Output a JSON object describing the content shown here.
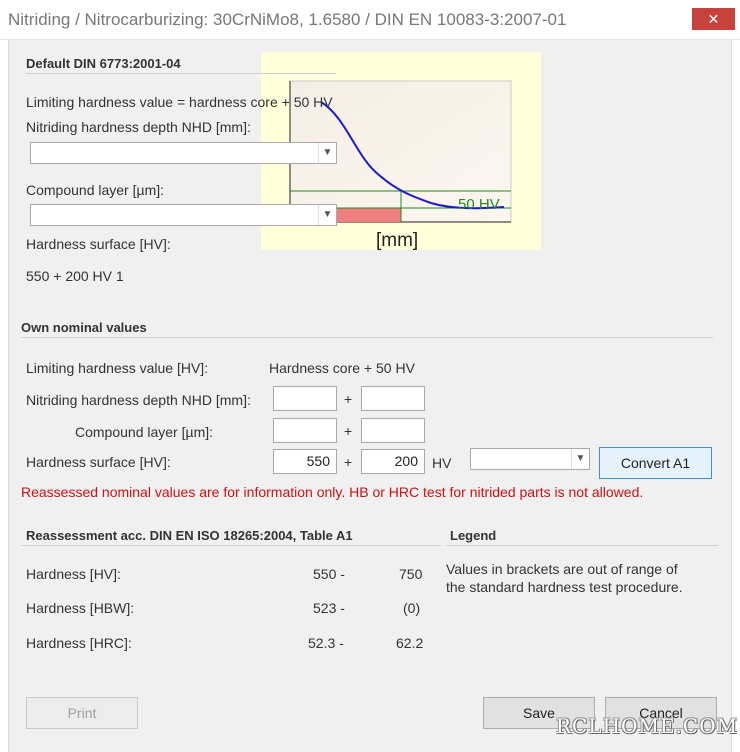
{
  "window": {
    "title": "Nitriding / Nitrocarburizing: 30CrNiMo8, 1.6580 / DIN EN 10083-3:2007-01",
    "close_glyph": "✕"
  },
  "default_section": {
    "title": "Default DIN 6773:2001-04",
    "limiting_text": "Limiting hardness value = hardness core + 50 HV",
    "nhd_label": "Nitriding hardness depth NHD [mm]:",
    "nhd_value": "",
    "compound_label": "Compound layer [µm]:",
    "compound_value": "",
    "surface_label": "Hardness surface [HV]:",
    "surface_value": "550 + 200 HV 1"
  },
  "chart": {
    "line_label": "50 HV",
    "axis_unit": "[mm]",
    "colors": {
      "curve": "#1a1acc",
      "reference": "#1f8a1f",
      "bar": "#f08080",
      "panel": "#ffffd9"
    }
  },
  "own_section": {
    "title": "Own nominal values",
    "limiting_label": "Limiting hardness value [HV]:",
    "limiting_value": "Hardness core + 50 HV",
    "nhd_label": "Nitriding hardness depth NHD [mm]:",
    "nhd_min": "",
    "nhd_max": "",
    "compound_label": "Compound layer [µm]:",
    "compound_min": "",
    "compound_max": "",
    "surface_label": "Hardness surface [HV]:",
    "surface_min": "550",
    "surface_max": "200",
    "plus": "+",
    "unit_hv": "HV",
    "scale_select_value": "",
    "convert_button": "Convert A1",
    "warning": "Reassessed nominal values are for information only. HB or HRC test for nitrided parts is not allowed."
  },
  "reassessment": {
    "title": "Reassessment acc. DIN EN ISO 18265:2004, Table A1",
    "rows": [
      {
        "label": "Hardness [HV]:",
        "from": "550 -",
        "to": "750"
      },
      {
        "label": "Hardness [HBW]:",
        "from": "523 -",
        "to": "(0)"
      },
      {
        "label": "Hardness [HRC]:",
        "from": "52.3 -",
        "to": "62.2"
      }
    ]
  },
  "legend": {
    "title": "Legend",
    "line1": "Values in brackets are out of range of",
    "line2": "the standard hardness test procedure."
  },
  "footer": {
    "print": "Print",
    "save": "Save",
    "cancel": "Cancel"
  },
  "watermark": "RCLHOME.COM"
}
